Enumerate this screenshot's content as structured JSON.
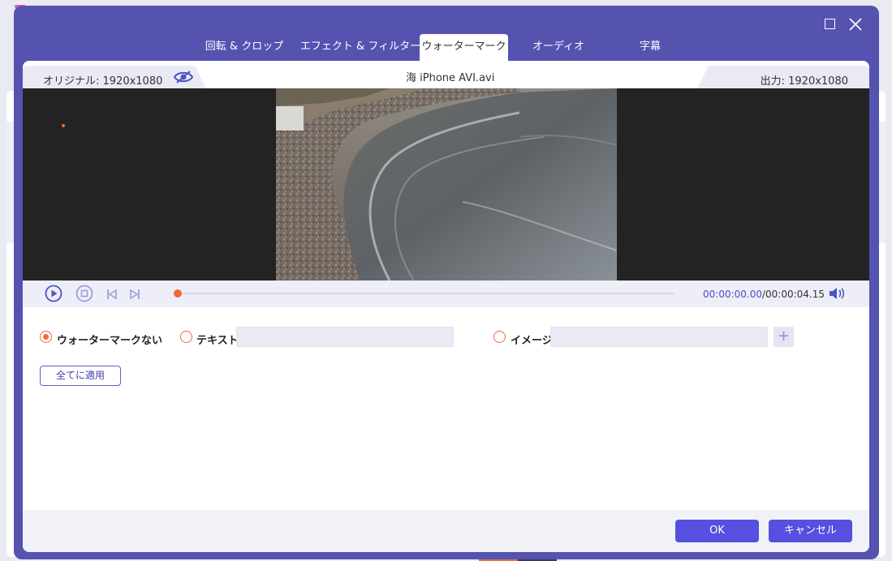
{
  "window": {
    "maximize_icon": "maximize-icon",
    "close_icon": "close-icon"
  },
  "tabs": [
    {
      "label": "回転 & クロップ",
      "active": false
    },
    {
      "label": "エフェクト & フィルター",
      "active": false
    },
    {
      "label": "ウォーターマーク",
      "active": true
    },
    {
      "label": "オーディオ",
      "active": false
    },
    {
      "label": "字幕",
      "active": false
    }
  ],
  "info": {
    "original": "オリジナル: 1920x1080",
    "file": "海  iPhone AVI.avi",
    "output": "出力: 1920x1080"
  },
  "player": {
    "current_time": "00:00:00.00",
    "total_time": "/00:00:04.15",
    "progress": 0.0
  },
  "watermark": {
    "none_label": "ウォーターマークない",
    "text_label": "テキスト",
    "text_value": "",
    "image_label": "イメージ",
    "image_value": "",
    "plus_label": "+",
    "selected": "none",
    "apply_label": "全てに適用"
  },
  "footer": {
    "ok_label": "OK",
    "cancel_label": "キャンセル"
  },
  "colors": {
    "accent": "#5550e0",
    "header": "#5552b0",
    "radio": "#ef6a3a"
  }
}
